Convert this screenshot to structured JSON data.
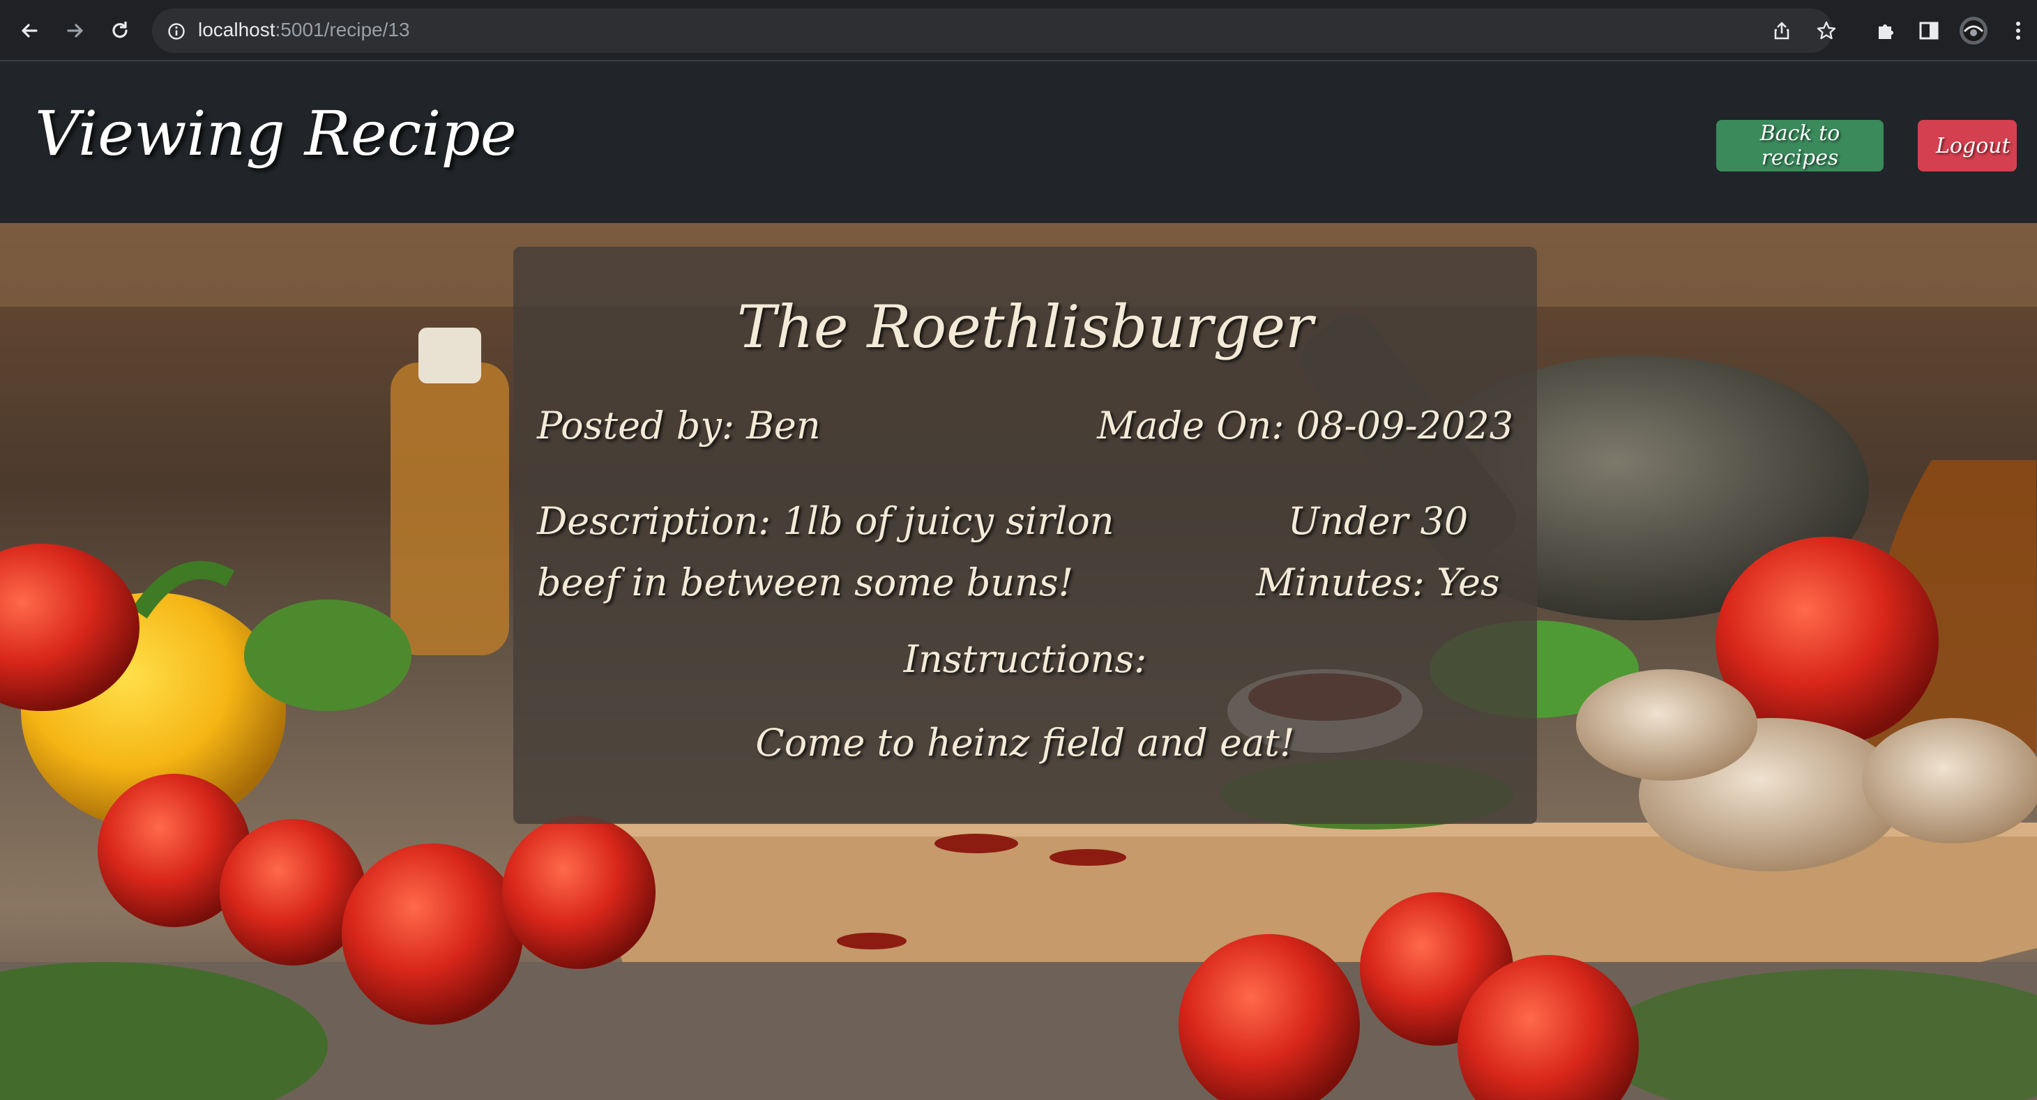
{
  "browser": {
    "url_host": "localhost",
    "url_path": ":5001/recipe/13"
  },
  "header": {
    "title": "Viewing Recipe",
    "back_label": "Back to recipes",
    "logout_label": "Logout"
  },
  "recipe": {
    "title": "The Roethlisburger",
    "posted_by": "Posted by: Ben",
    "made_on": "Made On: 08-09-2023",
    "description": "Description: 1lb of juicy sirlon beef in between some buns!",
    "under_30": "Under 30 Minutes: Yes",
    "instructions_label": "Instructions:",
    "instructions": "Come to heinz field and eat!"
  },
  "colors": {
    "header_bg": "#212529",
    "back_button": "#3a8a5c",
    "logout_button": "#d4404f"
  }
}
